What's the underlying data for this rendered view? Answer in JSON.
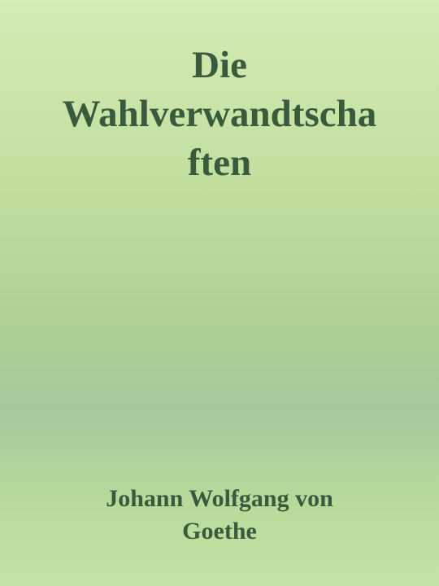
{
  "cover": {
    "title_lines": [
      "Die",
      "Wahlverwandtscha",
      "ften"
    ],
    "author_lines": [
      "Johann Wolfgang von",
      "Goethe"
    ],
    "colors": {
      "text": "#3a5a3e",
      "background_top": "#d3ebb4",
      "background_middle": "#a6c79c",
      "background_bottom": "#c3e2a5"
    }
  }
}
